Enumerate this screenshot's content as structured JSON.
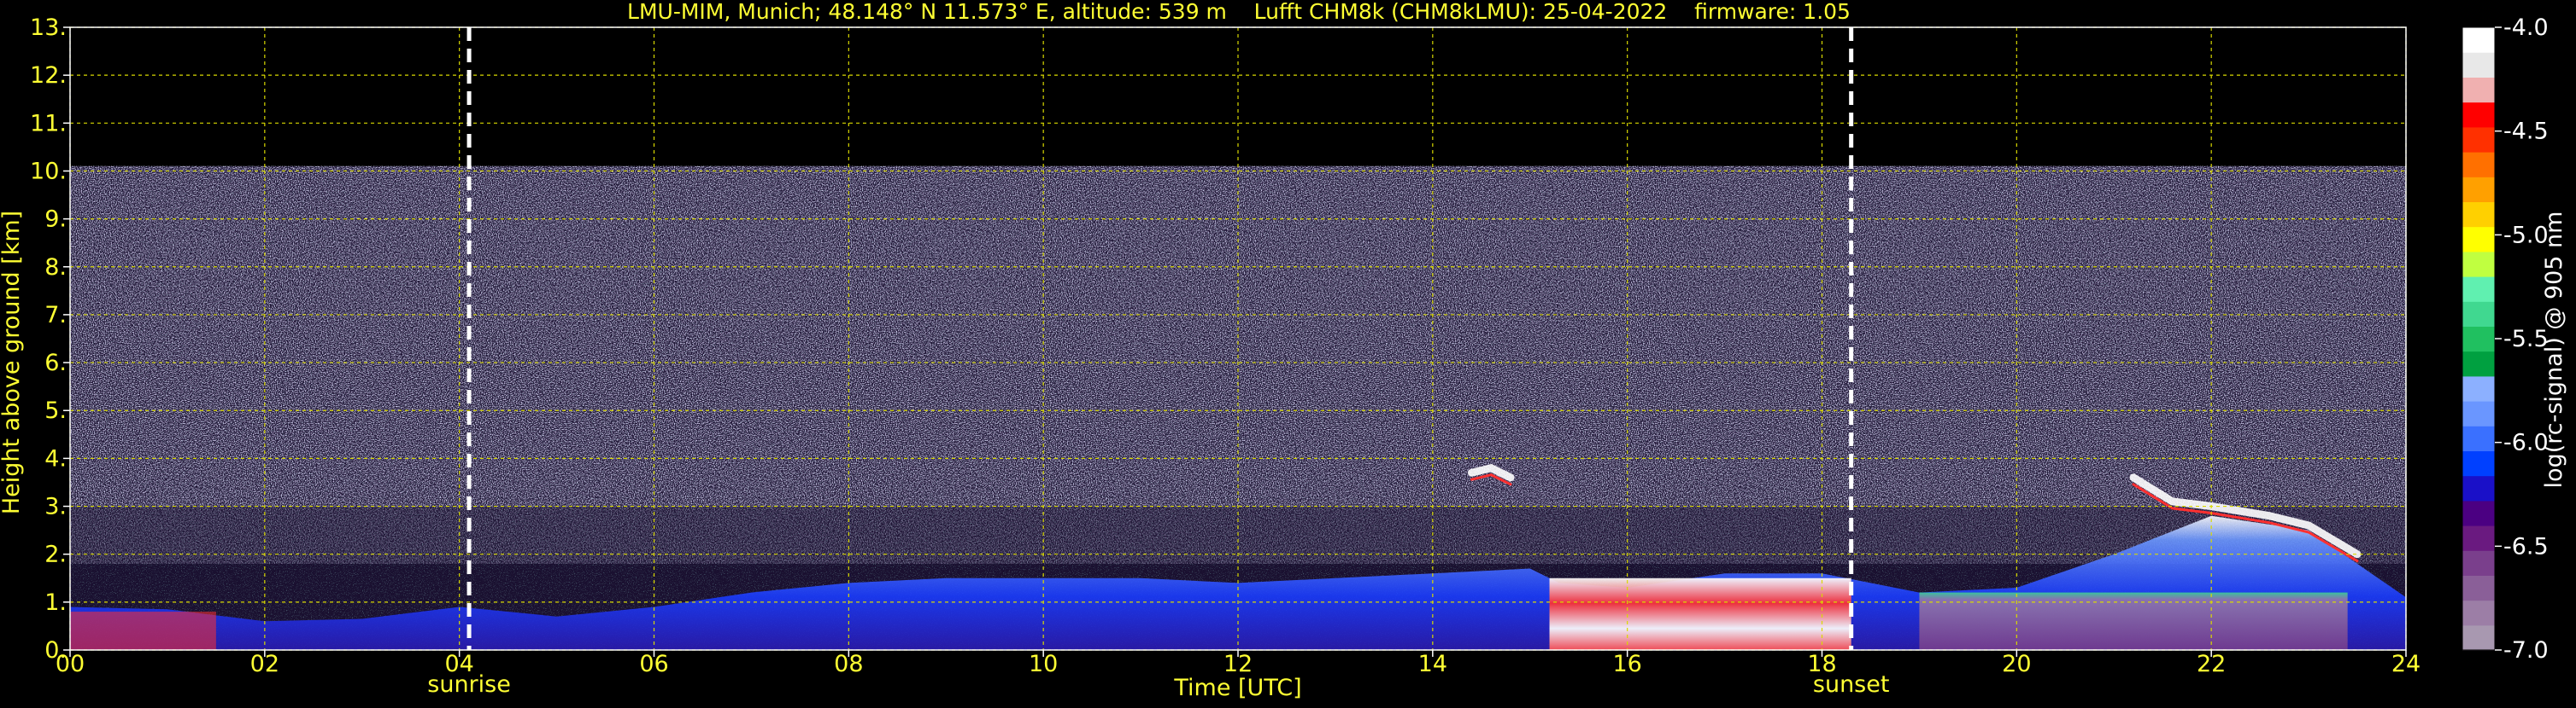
{
  "chart_data": {
    "type": "heatmap",
    "title": "LMU-MIM, Munich; 48.148° N 11.573° E, altitude: 539 m    Lufft CHM8k (CHM8kLMU): 25-04-2022    firmware: 1.05",
    "xlabel": "Time [UTC]",
    "ylabel": "Height above ground [km]",
    "xlim": [
      0,
      24
    ],
    "ylim": [
      0,
      13
    ],
    "x_ticks": [
      "00",
      "02",
      "04",
      "06",
      "08",
      "10",
      "12",
      "14",
      "16",
      "18",
      "20",
      "22",
      "24"
    ],
    "y_ticks": [
      "0.",
      "1.",
      "2.",
      "3.",
      "4.",
      "5.",
      "6.",
      "7.",
      "8.",
      "9.",
      "10.",
      "11.",
      "12.",
      "13."
    ],
    "grid": true,
    "grid_color": "#d9d900",
    "text_color": "#ffff33",
    "annotations": [
      {
        "label": "sunrise",
        "x": 4.1
      },
      {
        "label": "sunset",
        "x": 18.3
      }
    ],
    "colorbar": {
      "label": "log(rc-signal) @ 905 nm",
      "range": [
        -7.0,
        -4.0
      ],
      "ticks": [
        "-4.0",
        "-4.5",
        "-5.0",
        "-5.5",
        "-6.0",
        "-6.5",
        "-7.0"
      ],
      "colors": [
        "#a898b0",
        "#9c7ea6",
        "#8a5f98",
        "#7a3f8c",
        "#6a1a80",
        "#4b0082",
        "#1a10c8",
        "#0040ff",
        "#3a70ff",
        "#6a96ff",
        "#8cb0ff",
        "#00a040",
        "#20c060",
        "#40d890",
        "#60f0b0",
        "#c0ff40",
        "#ffff00",
        "#ffd000",
        "#ffa000",
        "#ff7000",
        "#ff3000",
        "#ff0000",
        "#f0b0b0",
        "#e8e8e8",
        "#ffffff"
      ]
    },
    "signal_top_km": 10.1,
    "layers": [
      {
        "name": "boundary layer",
        "points": [
          [
            0,
            0.9
          ],
          [
            1,
            0.85
          ],
          [
            2,
            0.6
          ],
          [
            3,
            0.65
          ],
          [
            4,
            0.9
          ],
          [
            5,
            0.7
          ],
          [
            6,
            0.9
          ],
          [
            7,
            1.2
          ],
          [
            8,
            1.4
          ],
          [
            9,
            1.5
          ],
          [
            10,
            1.5
          ],
          [
            11,
            1.5
          ],
          [
            12,
            1.4
          ],
          [
            13,
            1.5
          ],
          [
            14,
            1.6
          ],
          [
            15,
            1.7
          ],
          [
            15.3,
            1.4
          ],
          [
            16,
            1.3
          ],
          [
            17,
            1.6
          ],
          [
            18,
            1.6
          ],
          [
            19,
            1.2
          ],
          [
            20,
            1.3
          ],
          [
            21,
            2.0
          ],
          [
            22,
            2.8
          ],
          [
            23,
            2.5
          ],
          [
            24,
            1.1
          ]
        ]
      },
      {
        "name": "elevated aerosol 14.5h",
        "points": [
          [
            14.4,
            3.7
          ],
          [
            14.6,
            3.8
          ],
          [
            14.8,
            3.6
          ]
        ]
      },
      {
        "name": "elevated layer 21-23h",
        "points": [
          [
            21.2,
            3.6
          ],
          [
            21.6,
            3.1
          ],
          [
            22.0,
            3.0
          ],
          [
            22.6,
            2.8
          ],
          [
            23.0,
            2.6
          ],
          [
            23.5,
            2.0
          ]
        ]
      }
    ]
  }
}
